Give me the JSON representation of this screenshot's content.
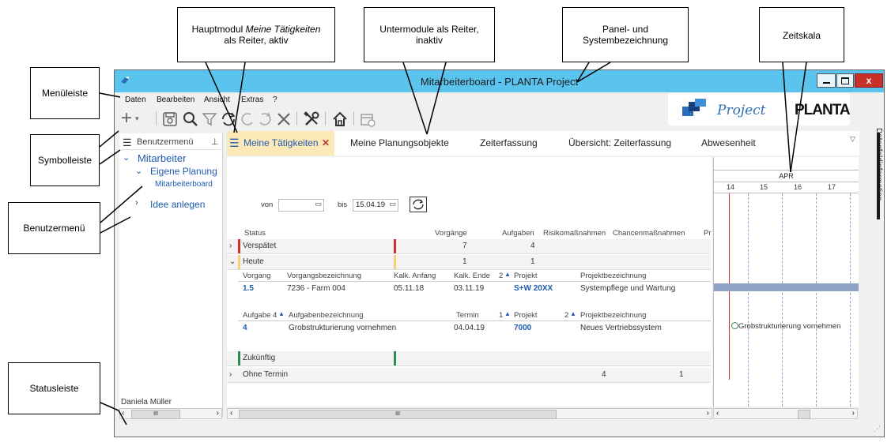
{
  "window": {
    "title": "Mitarbeiterboard - PLANTA Project",
    "min": "‒",
    "max": "□",
    "close": "x"
  },
  "menubar": {
    "items": [
      "Daten",
      "Bearbeiten",
      "Ansicht",
      "Extras",
      "?"
    ]
  },
  "brand": {
    "project": "Project",
    "planta": "PLANTA"
  },
  "left_panel": {
    "header": "Benutzermenü",
    "group": "Mitarbeiter",
    "sub": "Eigene Planung",
    "leaf": "Mitarbeiterboard",
    "idea": "Idee anlegen",
    "user": "Daniela Müller",
    "scroll_mid": "III"
  },
  "tabs": [
    {
      "label": "Meine Tätigkeiten",
      "active": true
    },
    {
      "label": "Meine Planungsobjekte"
    },
    {
      "label": "Zeiterfassung"
    },
    {
      "label": "Übersicht: Zeiterfassung"
    },
    {
      "label": "Abwesenheit"
    }
  ],
  "side_panel": {
    "label": "Datenfeldinformation"
  },
  "filter": {
    "von_label": "von",
    "von_value": "",
    "bis_label": "bis",
    "bis_value": "15.04.19"
  },
  "status_table": {
    "headers": [
      "Status",
      "Vorgänge",
      "Aufgaben",
      "Risikomaßnahmen",
      "Chancenmaßnahmen",
      "Pr"
    ],
    "rows": [
      {
        "status": "Verspätet",
        "vorgaenge": "7",
        "aufgaben": "4",
        "risk": "",
        "chance": ""
      },
      {
        "status": "Heute",
        "vorgaenge": "1",
        "aufgaben": "1",
        "risk": "",
        "chance": ""
      },
      {
        "status": "Zukünftig",
        "vorgaenge": "",
        "aufgaben": "",
        "risk": "",
        "chance": ""
      },
      {
        "status": "Ohne Termin",
        "vorgaenge": "",
        "aufgaben": "",
        "risk": "4",
        "chance": "1"
      }
    ]
  },
  "vorgang": {
    "headers": {
      "vorgang": "Vorgang",
      "bez": "Vorgangsbezeichnung",
      "anfang": "Kalk. Anfang",
      "ende": "Kalk. Ende",
      "sort": "2",
      "projekt": "Projekt",
      "projbez": "Projektbezeichnung"
    },
    "row": {
      "vorgang": "1.5",
      "bez": "7236 - Farm 004",
      "anfang": "05.11.18",
      "ende": "03.11.19",
      "projekt": "S+W 20XX",
      "projbez": "Systempflege und Wartung"
    }
  },
  "aufgabe": {
    "headers": {
      "aufgabe": "Aufgabe",
      "sort1": "4",
      "bez": "Aufgabenbezeichnung",
      "termin": "Termin",
      "sort2": "1",
      "projekt": "Projekt",
      "sort3": "2",
      "projbez": "Projektbezeichnung"
    },
    "row": {
      "aufgabe": "4",
      "bez": "Grobstrukturierung vornehmen",
      "termin": "04.04.19",
      "projekt": "7000",
      "projbez": "Neues Vertriebssystem"
    }
  },
  "gantt": {
    "month": "APR",
    "days": [
      "14",
      "15",
      "16",
      "17"
    ],
    "milestone_label": "Grobstrukturierung vornehmen"
  },
  "scroll": {
    "main_mid": "III"
  },
  "callouts": {
    "menueleiste": "Menüleiste",
    "symbolleiste": "Symbolleiste",
    "benutzermenue": "Benutzermenü",
    "statusleiste": "Statusleiste",
    "hauptmodul_a": "Hauptmodul ",
    "hauptmodul_b": "Meine Tätigkeiten",
    "hauptmodul_c": "als Reiter, aktiv",
    "untermodule": "Untermodule als Reiter, inaktiv",
    "panel": "Panel- und Systembezeichnung",
    "zeitskala": "Zeitskala"
  },
  "colors": {
    "titlebar": "#5bc4ee",
    "active_tab": "#fde9b8",
    "accent_red": "#d32f2f",
    "link_blue": "#1d5bb0",
    "bar": "#8fa3c7"
  }
}
